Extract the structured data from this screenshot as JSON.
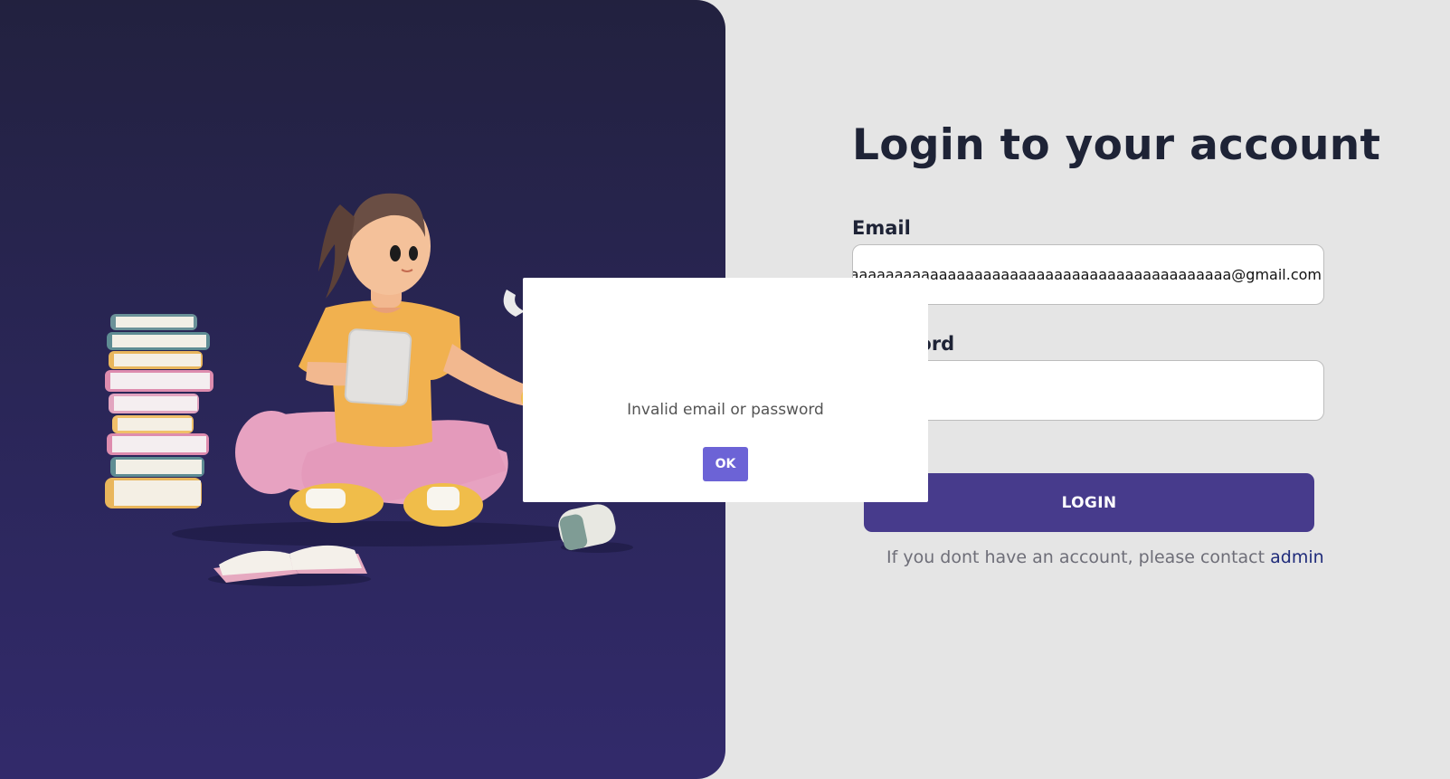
{
  "login": {
    "title": "Login to your account",
    "email_label": "Email",
    "email_value": "aaaaaaaaaaaaaaaaaaaaaaaaaaaaaaaaaaaaaaaaaaaaaaaaa@gmail.com",
    "password_label": "Password",
    "password_value": "••••••",
    "login_button": "LOGIN",
    "contact_text": "If you dont have an account, please contact ",
    "contact_link": "admin"
  },
  "dialog": {
    "message": "Invalid email or password",
    "ok_button": "OK"
  },
  "colors": {
    "panel_dark": "#2a2657",
    "accent": "#473b8c",
    "ok_button": "#6c63d6",
    "link": "#1f2b7a"
  }
}
